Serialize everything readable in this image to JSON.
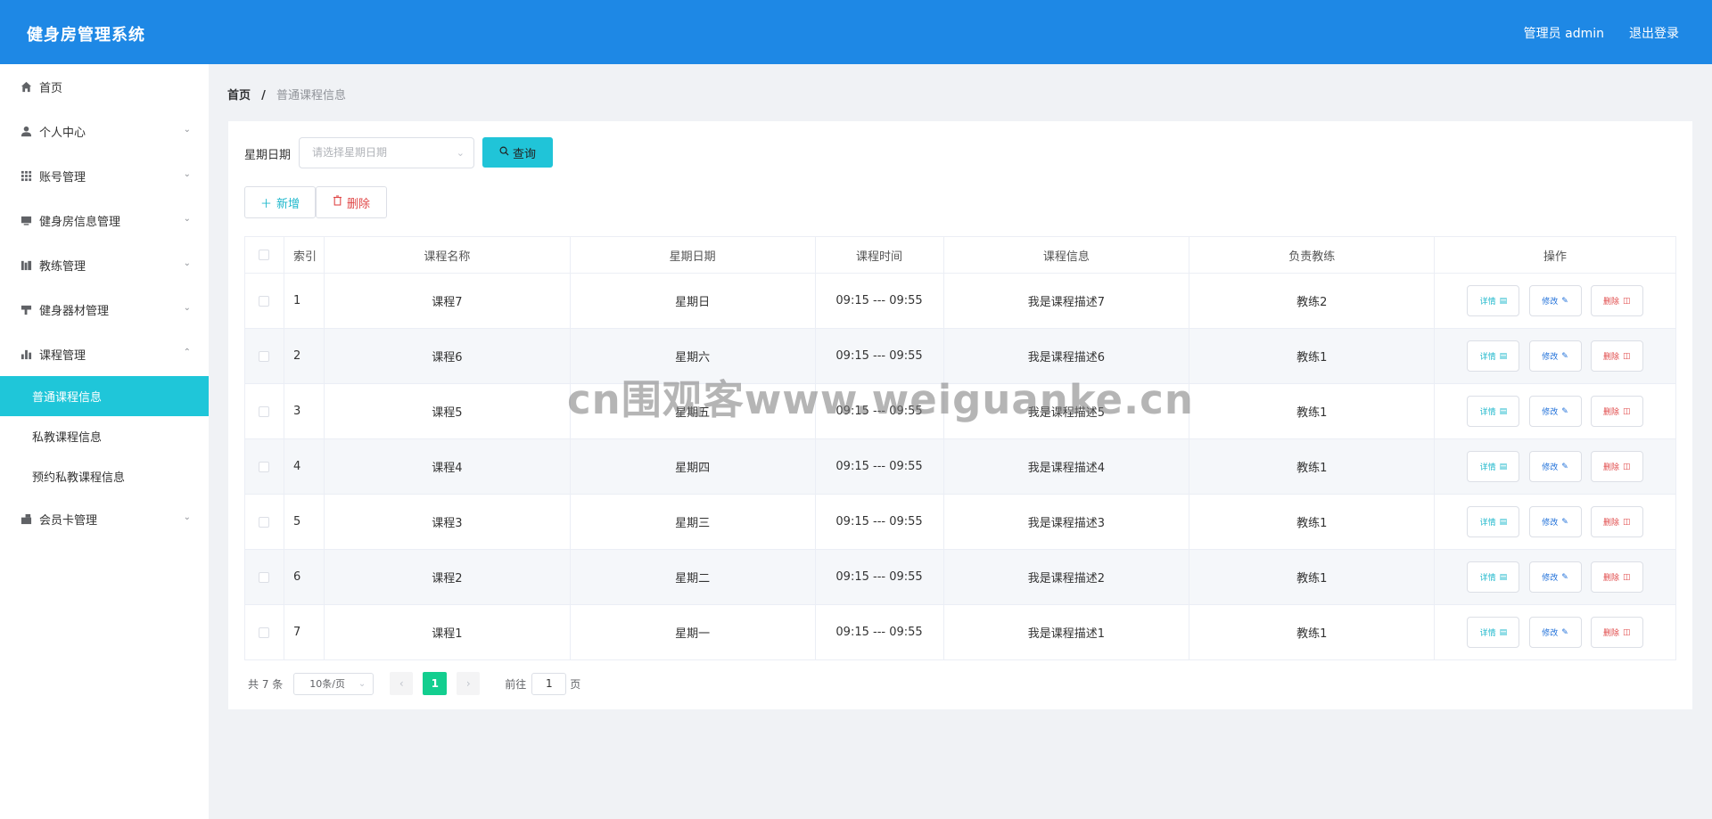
{
  "header": {
    "title": "健身房管理系统",
    "user": "管理员 admin",
    "logout": "退出登录"
  },
  "sidebar": {
    "items": [
      {
        "label": "首页",
        "icon": "home-icon"
      },
      {
        "label": "个人中心",
        "icon": "user-icon"
      },
      {
        "label": "账号管理",
        "icon": "grid-icon"
      },
      {
        "label": "健身房信息管理",
        "icon": "monitor-icon"
      },
      {
        "label": "教练管理",
        "icon": "coach-icon"
      },
      {
        "label": "健身器材管理",
        "icon": "equipment-icon"
      },
      {
        "label": "课程管理",
        "icon": "chart-icon"
      },
      {
        "label": "会员卡管理",
        "icon": "card-icon"
      }
    ],
    "course_submenu": [
      "普通课程信息",
      "私教课程信息",
      "预约私教课程信息"
    ]
  },
  "breadcrumb": {
    "home": "首页",
    "separator": "/",
    "current": "普通课程信息"
  },
  "search": {
    "label": "星期日期",
    "placeholder": "请选择星期日期",
    "button": "查询"
  },
  "actions": {
    "add": "新增",
    "delete": "删除"
  },
  "table": {
    "headers": [
      "索引",
      "课程名称",
      "星期日期",
      "课程时间",
      "课程信息",
      "负责教练",
      "操作"
    ],
    "op_labels": {
      "detail": "详情",
      "edit": "修改",
      "delete": "删除"
    },
    "rows": [
      {
        "index": "1",
        "name": "课程7",
        "day": "星期日",
        "time": "09:15 --- 09:55",
        "info": "我是课程描述7",
        "coach": "教练2"
      },
      {
        "index": "2",
        "name": "课程6",
        "day": "星期六",
        "time": "09:15 --- 09:55",
        "info": "我是课程描述6",
        "coach": "教练1"
      },
      {
        "index": "3",
        "name": "课程5",
        "day": "星期五",
        "time": "09:15 --- 09:55",
        "info": "我是课程描述5",
        "coach": "教练1"
      },
      {
        "index": "4",
        "name": "课程4",
        "day": "星期四",
        "time": "09:15 --- 09:55",
        "info": "我是课程描述4",
        "coach": "教练1"
      },
      {
        "index": "5",
        "name": "课程3",
        "day": "星期三",
        "time": "09:15 --- 09:55",
        "info": "我是课程描述3",
        "coach": "教练1"
      },
      {
        "index": "6",
        "name": "课程2",
        "day": "星期二",
        "time": "09:15 --- 09:55",
        "info": "我是课程描述2",
        "coach": "教练1"
      },
      {
        "index": "7",
        "name": "课程1",
        "day": "星期一",
        "time": "09:15 --- 09:55",
        "info": "我是课程描述1",
        "coach": "教练1"
      }
    ]
  },
  "pagination": {
    "total": "共 7 条",
    "page_size": "10条/页",
    "current_page": "1",
    "goto_label": "前往",
    "goto_value": "1",
    "page_unit": "页"
  },
  "watermark": "cn围观客www.weiguanke.cn",
  "colors": {
    "header": "#1e88e5",
    "accent": "#1fc6d9",
    "active_page": "#13ce8f",
    "danger": "#e04848"
  }
}
